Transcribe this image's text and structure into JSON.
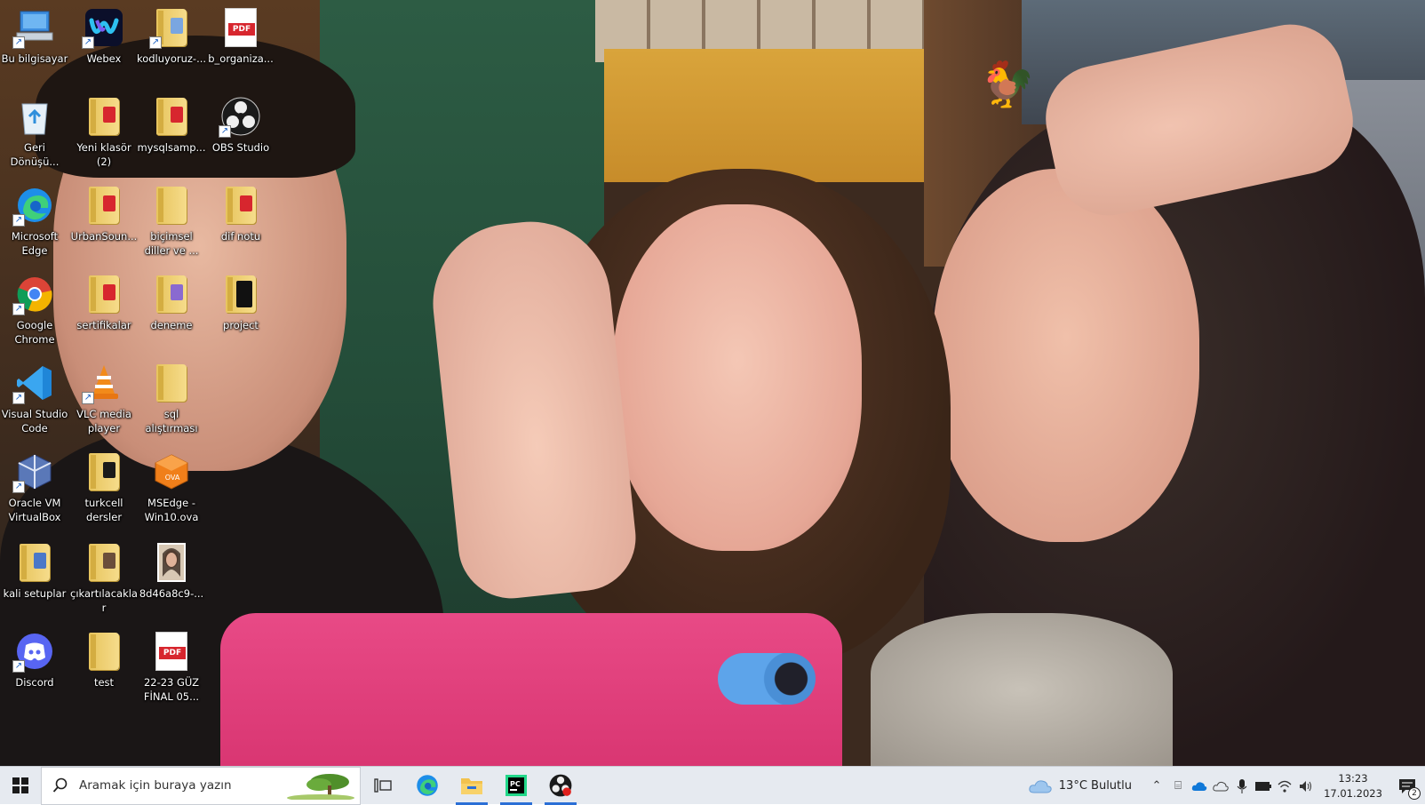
{
  "desktop_icons": [
    {
      "id": "this-pc",
      "label": "Bu bilgisayar",
      "icon": "computer-icon"
    },
    {
      "id": "webex",
      "label": "Webex",
      "icon": "webex-icon"
    },
    {
      "id": "kodluyoruz",
      "label": "kodluyoruz-...",
      "icon": "folder-icon"
    },
    {
      "id": "b-organiza",
      "label": "b_organiza...",
      "icon": "pdf-icon"
    },
    {
      "id": "recycle-bin",
      "label": "Geri Dönüşü...",
      "icon": "recycle-bin-icon"
    },
    {
      "id": "yeni-klasor",
      "label": "Yeni klasör (2)",
      "icon": "folder-icon"
    },
    {
      "id": "mysqlsamp",
      "label": "mysqlsamp...",
      "icon": "folder-icon"
    },
    {
      "id": "obs",
      "label": "OBS Studio",
      "icon": "obs-icon"
    },
    {
      "id": "edge",
      "label": "Microsoft Edge",
      "icon": "edge-icon"
    },
    {
      "id": "urbansound",
      "label": "UrbanSoun...",
      "icon": "folder-icon"
    },
    {
      "id": "bicimsel",
      "label": "biçimsel diller ve ...",
      "icon": "folder-icon"
    },
    {
      "id": "dif-notu",
      "label": "dif notu",
      "icon": "folder-icon"
    },
    {
      "id": "chrome",
      "label": "Google Chrome",
      "icon": "chrome-icon"
    },
    {
      "id": "sertifikalar",
      "label": "sertifikalar",
      "icon": "folder-icon"
    },
    {
      "id": "deneme",
      "label": "deneme",
      "icon": "folder-icon"
    },
    {
      "id": "project",
      "label": "project",
      "icon": "folder-icon"
    },
    {
      "id": "vscode",
      "label": "Visual Studio Code",
      "icon": "vscode-icon"
    },
    {
      "id": "vlc",
      "label": "VLC media player",
      "icon": "vlc-icon"
    },
    {
      "id": "sql-alistirmasi",
      "label": "sql alıştırması",
      "icon": "folder-icon"
    },
    {
      "id": "virtualbox",
      "label": "Oracle VM VirtualBox",
      "icon": "virtualbox-icon"
    },
    {
      "id": "turkcell",
      "label": "turkcell dersler",
      "icon": "folder-icon"
    },
    {
      "id": "msedge-ova",
      "label": "MSEdge - Win10.ova",
      "icon": "ova-icon"
    },
    {
      "id": "kali",
      "label": "kali setuplar",
      "icon": "folder-icon"
    },
    {
      "id": "cikartilacaklar",
      "label": "çıkartılacaklar",
      "icon": "folder-icon"
    },
    {
      "id": "8d46",
      "label": "8d46a8c9-...",
      "icon": "image-icon"
    },
    {
      "id": "discord",
      "label": "Discord",
      "icon": "discord-icon"
    },
    {
      "id": "test",
      "label": "test",
      "icon": "folder-icon"
    },
    {
      "id": "final",
      "label": "22-23 GÜZ FİNAL 05...",
      "icon": "pdf-icon"
    }
  ],
  "taskbar": {
    "search_placeholder": "Aramak için buraya yazın",
    "weather": "13°C  Bulutlu",
    "time": "13:23",
    "date": "17.01.2023",
    "notification_count": "2"
  },
  "colors": {
    "taskbar_bg": "#e6eaf0",
    "accent": "#2b6fd6"
  }
}
